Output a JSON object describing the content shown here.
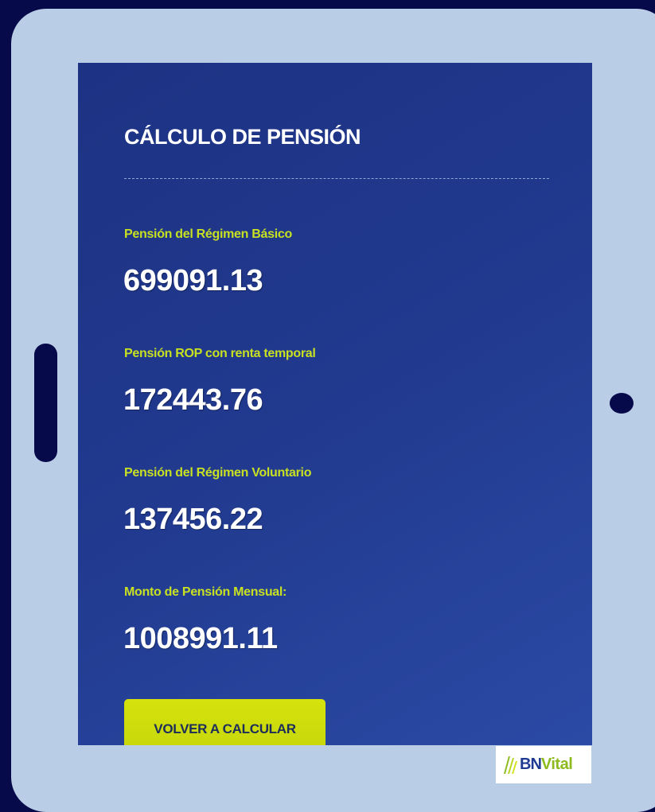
{
  "page": {
    "title": "CÁLCULO DE PENSIÓN"
  },
  "results": [
    {
      "label": "Pensión del Régimen Básico",
      "value": "699091.13"
    },
    {
      "label": "Pensión ROP con renta temporal",
      "value": "172443.76"
    },
    {
      "label": "Pensión del Régimen Voluntario",
      "value": "137456.22"
    },
    {
      "label": "Monto de Pensión Mensual:",
      "value": "1008991.11"
    }
  ],
  "actions": {
    "recalculate_label": "VOLVER A CALCULAR"
  },
  "brand": {
    "logo_part1": "BN",
    "logo_part2": "Vital",
    "primary_color": "#1f3a93",
    "accent_color": "#c8e022"
  },
  "icons": {
    "logo_mark": "bnvital-logo-mark"
  }
}
